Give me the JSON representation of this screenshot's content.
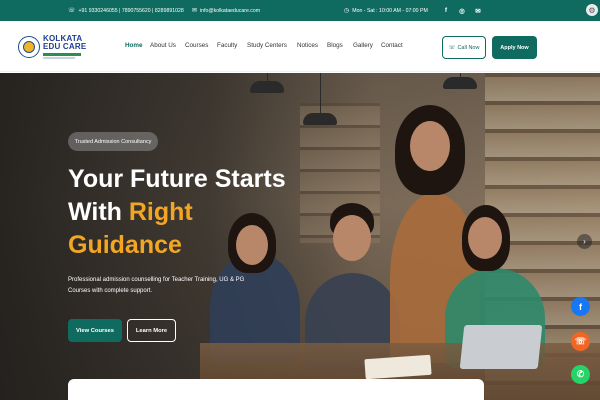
{
  "topbar": {
    "phones": "+91 9330246055 | 7890755620 | 8289891028",
    "email": "info@kolkataeducare.com",
    "hours": "Mon - Sat : 10:00 AM - 07:00 PM",
    "social": [
      "facebook-icon",
      "instagram-icon",
      "mail-icon"
    ]
  },
  "brand": {
    "line1": "KOLKATA",
    "line2": "EDU CARE"
  },
  "nav": {
    "items": [
      "Home",
      "About Us",
      "Courses",
      "Faculty",
      "Study Centers",
      "Notices",
      "Blogs",
      "Gallery",
      "Contact"
    ],
    "active": "Home"
  },
  "actions": {
    "call": "Call Now",
    "apply": "Apply Now"
  },
  "hero": {
    "badge": "Trusted Admission Consultancy",
    "title_line1": "Your Future Starts",
    "title_line2_plain": "With ",
    "title_line2_highlight": "Right",
    "title_line3_highlight": "Guidance",
    "lead": "Professional admission counselling for Teacher Training, UG & PG Courses with complete support.",
    "btn_primary": "View Courses",
    "btn_secondary": "Learn More"
  },
  "colors": {
    "brand_teal": "#0f6b5f",
    "highlight_orange": "#f2a623"
  }
}
